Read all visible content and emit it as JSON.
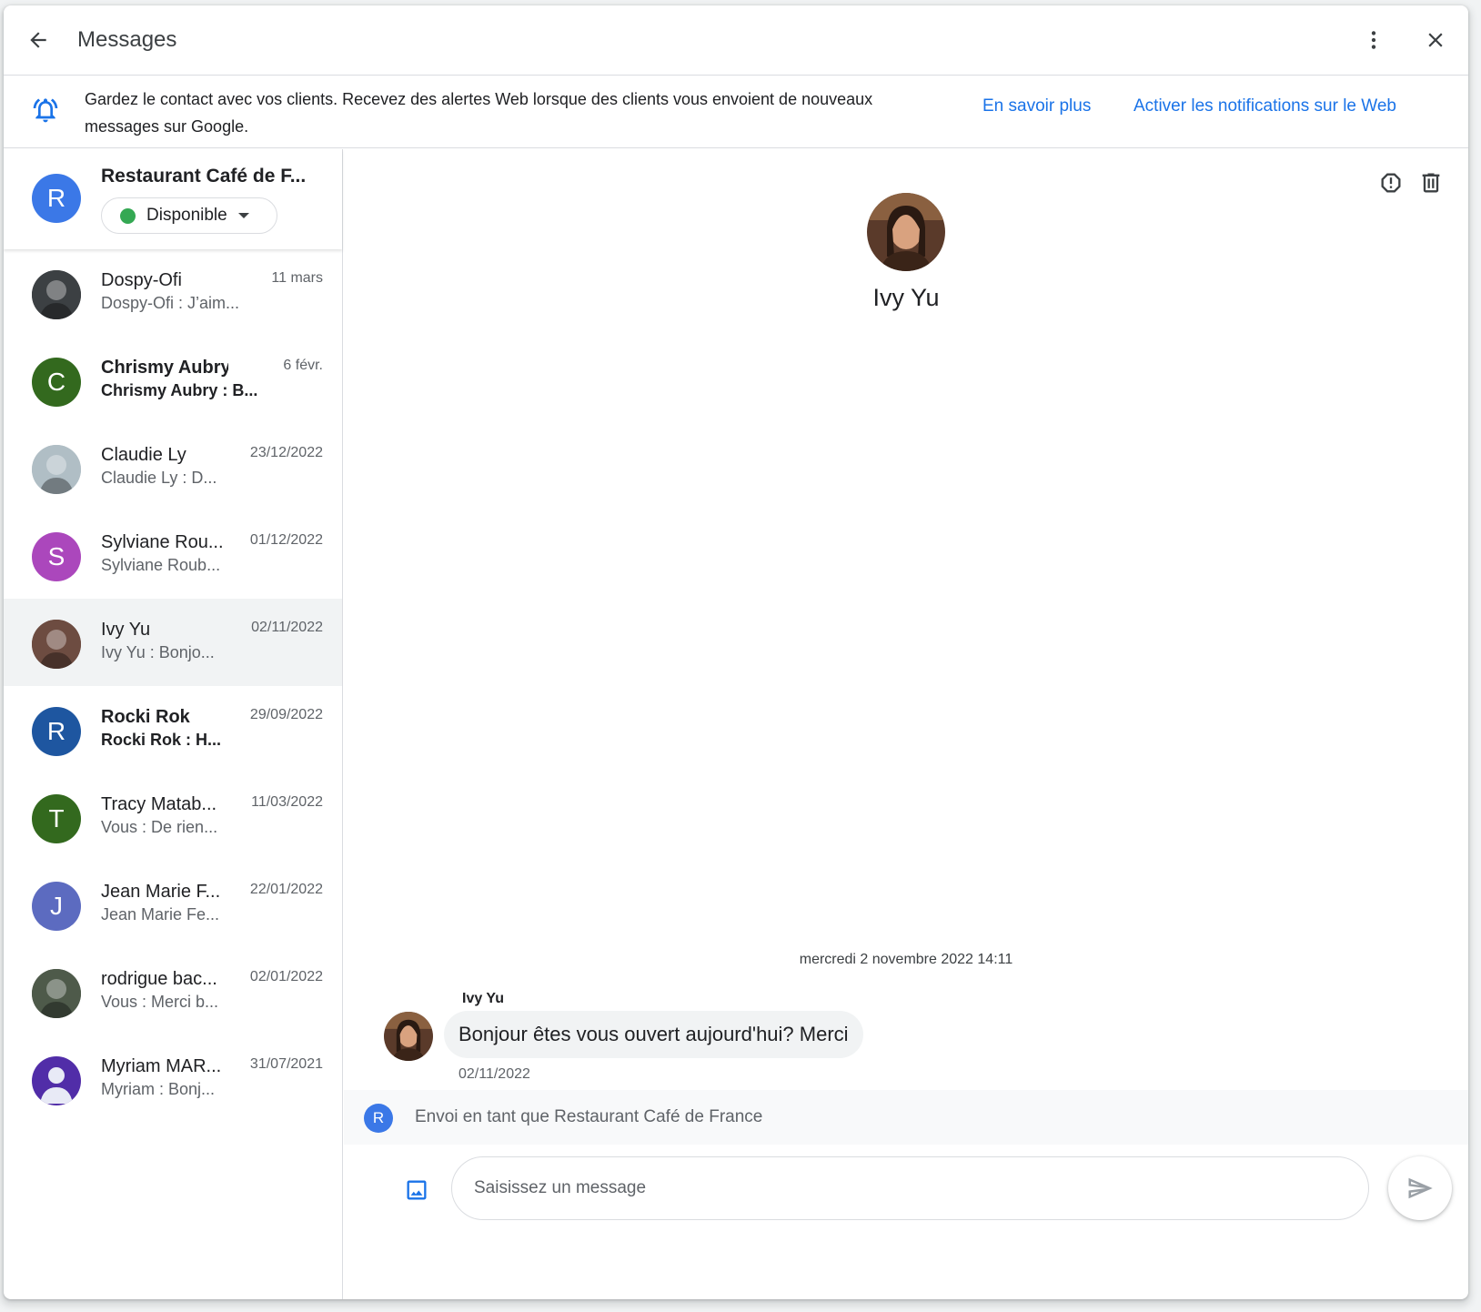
{
  "header": {
    "title": "Messages",
    "icons": {
      "back": "arrow-back-icon",
      "more": "more-vert-icon",
      "close": "close-icon"
    }
  },
  "banner": {
    "text": "Gardez le contact avec vos clients. Recevez des alertes Web lorsque des clients vous envoient de nouveaux messages sur Google.",
    "learn_more": "En savoir plus",
    "enable_notifications": "Activer les notifications sur le Web"
  },
  "business": {
    "initial": "R",
    "name": "Restaurant Café de F...",
    "status": "Disponible"
  },
  "conversations": [
    {
      "name": "Dospy-Ofi",
      "snippet": "Dospy-Ofi : J’aim...",
      "date": "11 mars",
      "unread": false,
      "initial": "",
      "color": "#3c4043",
      "photo": true
    },
    {
      "name": "Chrismy Aubry",
      "snippet": "Chrismy Aubry : B...",
      "date": "6 févr.",
      "unread": true,
      "initial": "C",
      "color": "#33691e"
    },
    {
      "name": "Claudie Ly",
      "snippet": "Claudie Ly : D...",
      "date": "23/12/2022",
      "unread": false,
      "initial": "",
      "color": "#b0bec5",
      "photo": true
    },
    {
      "name": "Sylviane Rou...",
      "snippet": "Sylviane Roub...",
      "date": "01/12/2022",
      "unread": false,
      "initial": "S",
      "color": "#ab47bc"
    },
    {
      "name": "Ivy Yu",
      "snippet": "Ivy Yu : Bonjo...",
      "date": "02/11/2022",
      "unread": false,
      "initial": "",
      "color": "#6d4c41",
      "photo": true,
      "active": true
    },
    {
      "name": "Rocki Rok",
      "snippet": "Rocki Rok : H...",
      "date": "29/09/2022",
      "unread": true,
      "initial": "R",
      "color": "#1e56a0"
    },
    {
      "name": "Tracy Matab...",
      "snippet": "Vous : De rien...",
      "date": "11/03/2022",
      "unread": false,
      "initial": "T",
      "color": "#33691e"
    },
    {
      "name": "Jean Marie F...",
      "snippet": "Jean Marie Fe...",
      "date": "22/01/2022",
      "unread": false,
      "initial": "J",
      "color": "#5c6bc0"
    },
    {
      "name": "rodrigue bac...",
      "snippet": "Vous : Merci b...",
      "date": "02/01/2022",
      "unread": false,
      "initial": "",
      "color": "#4e5a4a",
      "photo": true
    },
    {
      "name": "Myriam MAR...",
      "snippet": "Myriam : Bonj...",
      "date": "31/07/2021",
      "unread": false,
      "initial": "",
      "color": "#512da8",
      "person": true
    }
  ],
  "chat": {
    "contact_name": "Ivy Yu",
    "day_stamp": "mercredi 2 novembre 2022 14:11",
    "sender": "Ivy Yu",
    "message": "Bonjour êtes vous ouvert aujourd'hui? Merci",
    "message_date": "02/11/2022",
    "send_as_initial": "R",
    "send_as": "Envoi en tant que Restaurant Café de France",
    "input_placeholder": "Saisissez un message",
    "icons": {
      "report": "report-icon",
      "delete": "trash-icon",
      "image": "image-icon",
      "send": "send-icon"
    }
  }
}
